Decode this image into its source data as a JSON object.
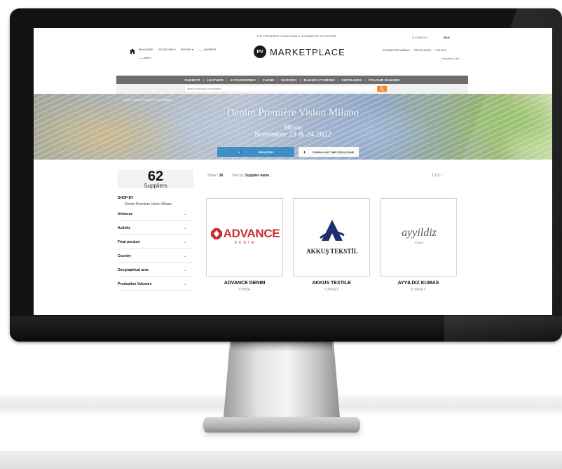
{
  "colors": {
    "brand_orange": "#f08a2a",
    "accent_blue": "#3f8fc6",
    "category_bar": "#6d6d6d",
    "advance_red": "#c8302d"
  },
  "header": {
    "tagline": "THE PREMIERE VISION B2B E-COMMERCE PLATFORM",
    "nav_items": [
      "MAGAZINE",
      "SOURCING ▾",
      "SHOWS ▾",
      "——AWARDS"
    ],
    "nav_sub": "——INFO",
    "logo_badge": "PV",
    "logo_text": "MARKETPLACE",
    "search_label": "SEARCH",
    "language": "EN ▾",
    "right_links": [
      "EXHIBITORS AREA ▾",
      "PRESS AREA",
      "LOG IN ▾"
    ],
    "right_sub": "Favorites   Cart"
  },
  "categories": [
    "FABRICS",
    "LEATHER",
    "ACCESSORIES",
    "YARNS",
    "DESIGNS",
    "MANUFACTURING",
    "SUPPLIERS",
    "COLOUR RANGES"
  ],
  "search": {
    "placeholder": "Search a product or a supplier"
  },
  "hero": {
    "breadcrumb": "Home > Denim Première Vision Milano",
    "title": "Denim Première Vision Milano",
    "place": "Milano",
    "date": "November 23 & 24 2022",
    "button1": "REGISTER",
    "button2": "DOWNLOAD THE CATALOGUE"
  },
  "results": {
    "count": "62",
    "label": "Suppliers",
    "show_label": "Show :",
    "show_value": "30",
    "sort_label": "Sort by:",
    "sort_value": "Supplier name",
    "pagination": "1  2  3 ›"
  },
  "sidebar": {
    "heading": "SHOP BY",
    "event": "Denim Première Vision Milano",
    "facets": [
      "Universe",
      "Activity",
      "Final product",
      "Country",
      "Geographical area",
      "Production Volumes"
    ]
  },
  "suppliers": [
    {
      "name": "ADVANCE DENIM",
      "country": "CHINA",
      "logo_text": "ADVANCE",
      "logo_sub": "DENIM"
    },
    {
      "name": "AKKUS TEXTILE",
      "country": "TURKEY",
      "logo_text": "AKKUŞ TEKSTİL"
    },
    {
      "name": "AYYILDIZ KUMAS",
      "country": "TURKEY",
      "logo_text": "ayyildiz",
      "logo_sub": "KUMAS"
    }
  ]
}
